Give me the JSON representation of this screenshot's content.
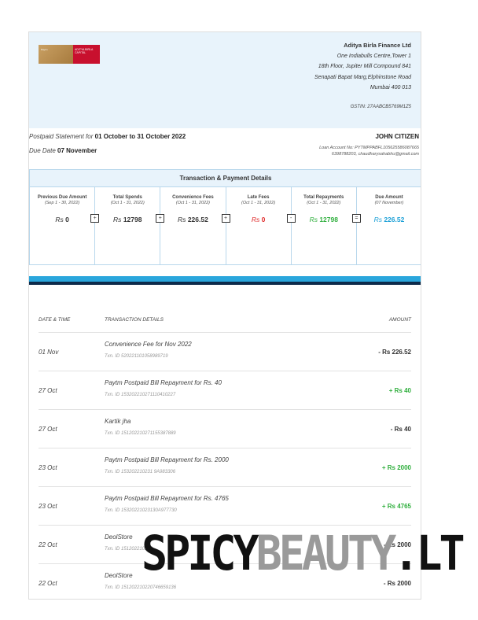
{
  "header": {
    "company": "Aditya Birla Finance Ltd",
    "address": [
      "One Indiabulls Centre,Tower 1",
      "18th Floor, Jupiter Mill Compound 841",
      "Senapati Bapat Marg,Elphinstone Road",
      "Mumbai 400 013"
    ],
    "gstin": "GSTIN:   27AABCB5769M1Z5",
    "logo_left_text": "Paytm",
    "logo_right_text": "ADITYA BIRLA CAPITAL"
  },
  "statement": {
    "period_label": "Postpaid Statement for",
    "period_value": "01 October to 31 October 2022",
    "due_label": "Due Date",
    "due_value": "07 November",
    "customer_name": "JOHN CITIZEN",
    "loan_line": "Loan Account No: PYTMPPABFL105625586087665",
    "contact_line": "6398788203,  chaudharysahabhu@gmail.com"
  },
  "summary": {
    "title": "Transaction & Payment Details",
    "columns": [
      {
        "label": "Previous Due Amount",
        "period": "(Sep 1 - 30, 2022)",
        "currency": "Rs",
        "value": "0",
        "color": "#333333",
        "op": "+"
      },
      {
        "label": "Total Spends",
        "period": "(Oct 1 - 31, 2022)",
        "currency": "Rs",
        "value": "12798",
        "color": "#333333",
        "op": "+"
      },
      {
        "label": "Convenience Fees",
        "period": "(Oct 1 - 31, 2022)",
        "currency": "Rs",
        "value": "226.52",
        "color": "#333333",
        "op": "+"
      },
      {
        "label": "Late Fees",
        "period": "(Oct 1 - 31, 2022)",
        "currency": "Rs",
        "value": "0",
        "color": "#e02b2b",
        "op": "-"
      },
      {
        "label": "Total Repayments",
        "period": "(Oct 1 - 31, 2022)",
        "currency": "Rs",
        "value": "12798",
        "color": "#2eae3c",
        "op": "="
      },
      {
        "label": "Due Amount",
        "period": "(07 November)",
        "currency": "Rs",
        "value": "226.52",
        "color": "#1a9fd6",
        "op": ""
      }
    ]
  },
  "table": {
    "col_date": "DATE & TIME",
    "col_details": "TRANSACTION DETAILS",
    "col_amount": "AMOUNT",
    "rows": [
      {
        "date": "01 Nov",
        "desc": "Convenience Fee for Nov 2022",
        "txn": "Txn. ID 520221101058989719",
        "amount": "- Rs 226.52",
        "type": "neg"
      },
      {
        "date": "27 Oct",
        "desc": "Paytm Postpaid Bill Repayment for Rs. 40",
        "txn": "Txn. ID 153202210271110410227",
        "amount": "+ Rs 40",
        "type": "pos"
      },
      {
        "date": "27 Oct",
        "desc": "Kartik jha",
        "txn": "Txn. ID 151202210271155387889",
        "amount": "- Rs 40",
        "type": "neg"
      },
      {
        "date": "23 Oct",
        "desc": "Paytm Postpaid Bill Repayment for Rs. 2000",
        "txn": "Txn. ID 153202210231 9A983306",
        "amount": "+ Rs 2000",
        "type": "pos"
      },
      {
        "date": "23 Oct",
        "desc": "Paytm Postpaid Bill Repayment for Rs. 4765",
        "txn": "Txn. ID 15320221023130A977730",
        "amount": "+ Rs 4765",
        "type": "pos"
      },
      {
        "date": "22 Oct",
        "desc": "DeolStore",
        "txn": "Txn. ID 151202210220",
        "amount": "- Rs 2000",
        "type": "neg"
      },
      {
        "date": "22 Oct",
        "desc": "DeolStore",
        "txn": "Txn. ID 151202210220746659136",
        "amount": "- Rs 2000",
        "type": "neg"
      }
    ]
  },
  "watermark": {
    "part1": "SPICY",
    "part2": "BEAUTY",
    "part3": ".LT"
  }
}
